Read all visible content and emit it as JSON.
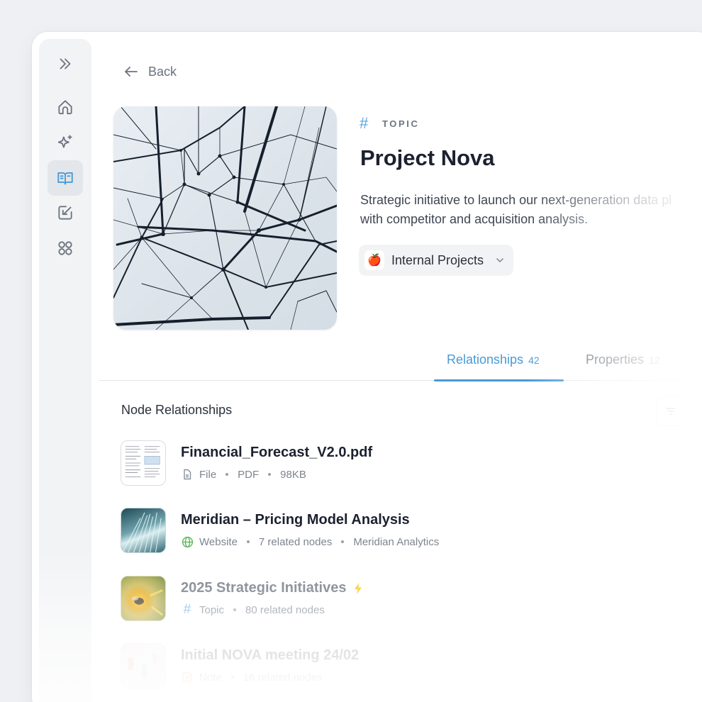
{
  "nav": {
    "back_label": "Back"
  },
  "sidebar": {
    "items": [
      {
        "icon": "expand-icon"
      },
      {
        "icon": "home-icon"
      },
      {
        "icon": "sparkle-icon"
      },
      {
        "icon": "book-icon",
        "active": true
      },
      {
        "icon": "inbox-arrow-icon"
      },
      {
        "icon": "apps-grid-icon"
      }
    ]
  },
  "topic": {
    "type_symbol": "#",
    "type_label": "TOPIC",
    "title": "Project Nova",
    "description_line1": "Strategic initiative to launch our next-generation data pl",
    "description_line2": "with competitor and acquisition analysis.",
    "collection": {
      "emoji": "🍎",
      "label": "Internal Projects"
    }
  },
  "tabs": [
    {
      "label": "Relationships",
      "count": "42",
      "active": true
    },
    {
      "label": "Properties",
      "count": "12",
      "active": false
    }
  ],
  "relationships": {
    "section_title": "Node Relationships",
    "items": [
      {
        "name": "Financial_Forecast_V2.0.pdf",
        "type": "File",
        "meta": [
          "PDF",
          "98KB"
        ],
        "icon": "file-icon"
      },
      {
        "name": "Meridian – Pricing Model Analysis",
        "type": "Website",
        "meta": [
          "7 related nodes",
          "Meridian Analytics"
        ],
        "icon": "globe-icon"
      },
      {
        "name": "2025 Strategic Initiatives",
        "type": "Topic",
        "meta": [
          "80 related nodes"
        ],
        "icon": "hash-icon",
        "badge": "lightning-icon"
      },
      {
        "name": "Initial NOVA meeting 24/02",
        "type": "Note",
        "meta": [
          "16 related nodes"
        ],
        "icon": "note-icon"
      }
    ]
  },
  "colors": {
    "accent": "#4a9ad6",
    "text": "#1c2130",
    "muted": "#7e858f",
    "sidebar_bg": "#f2f3f5"
  }
}
